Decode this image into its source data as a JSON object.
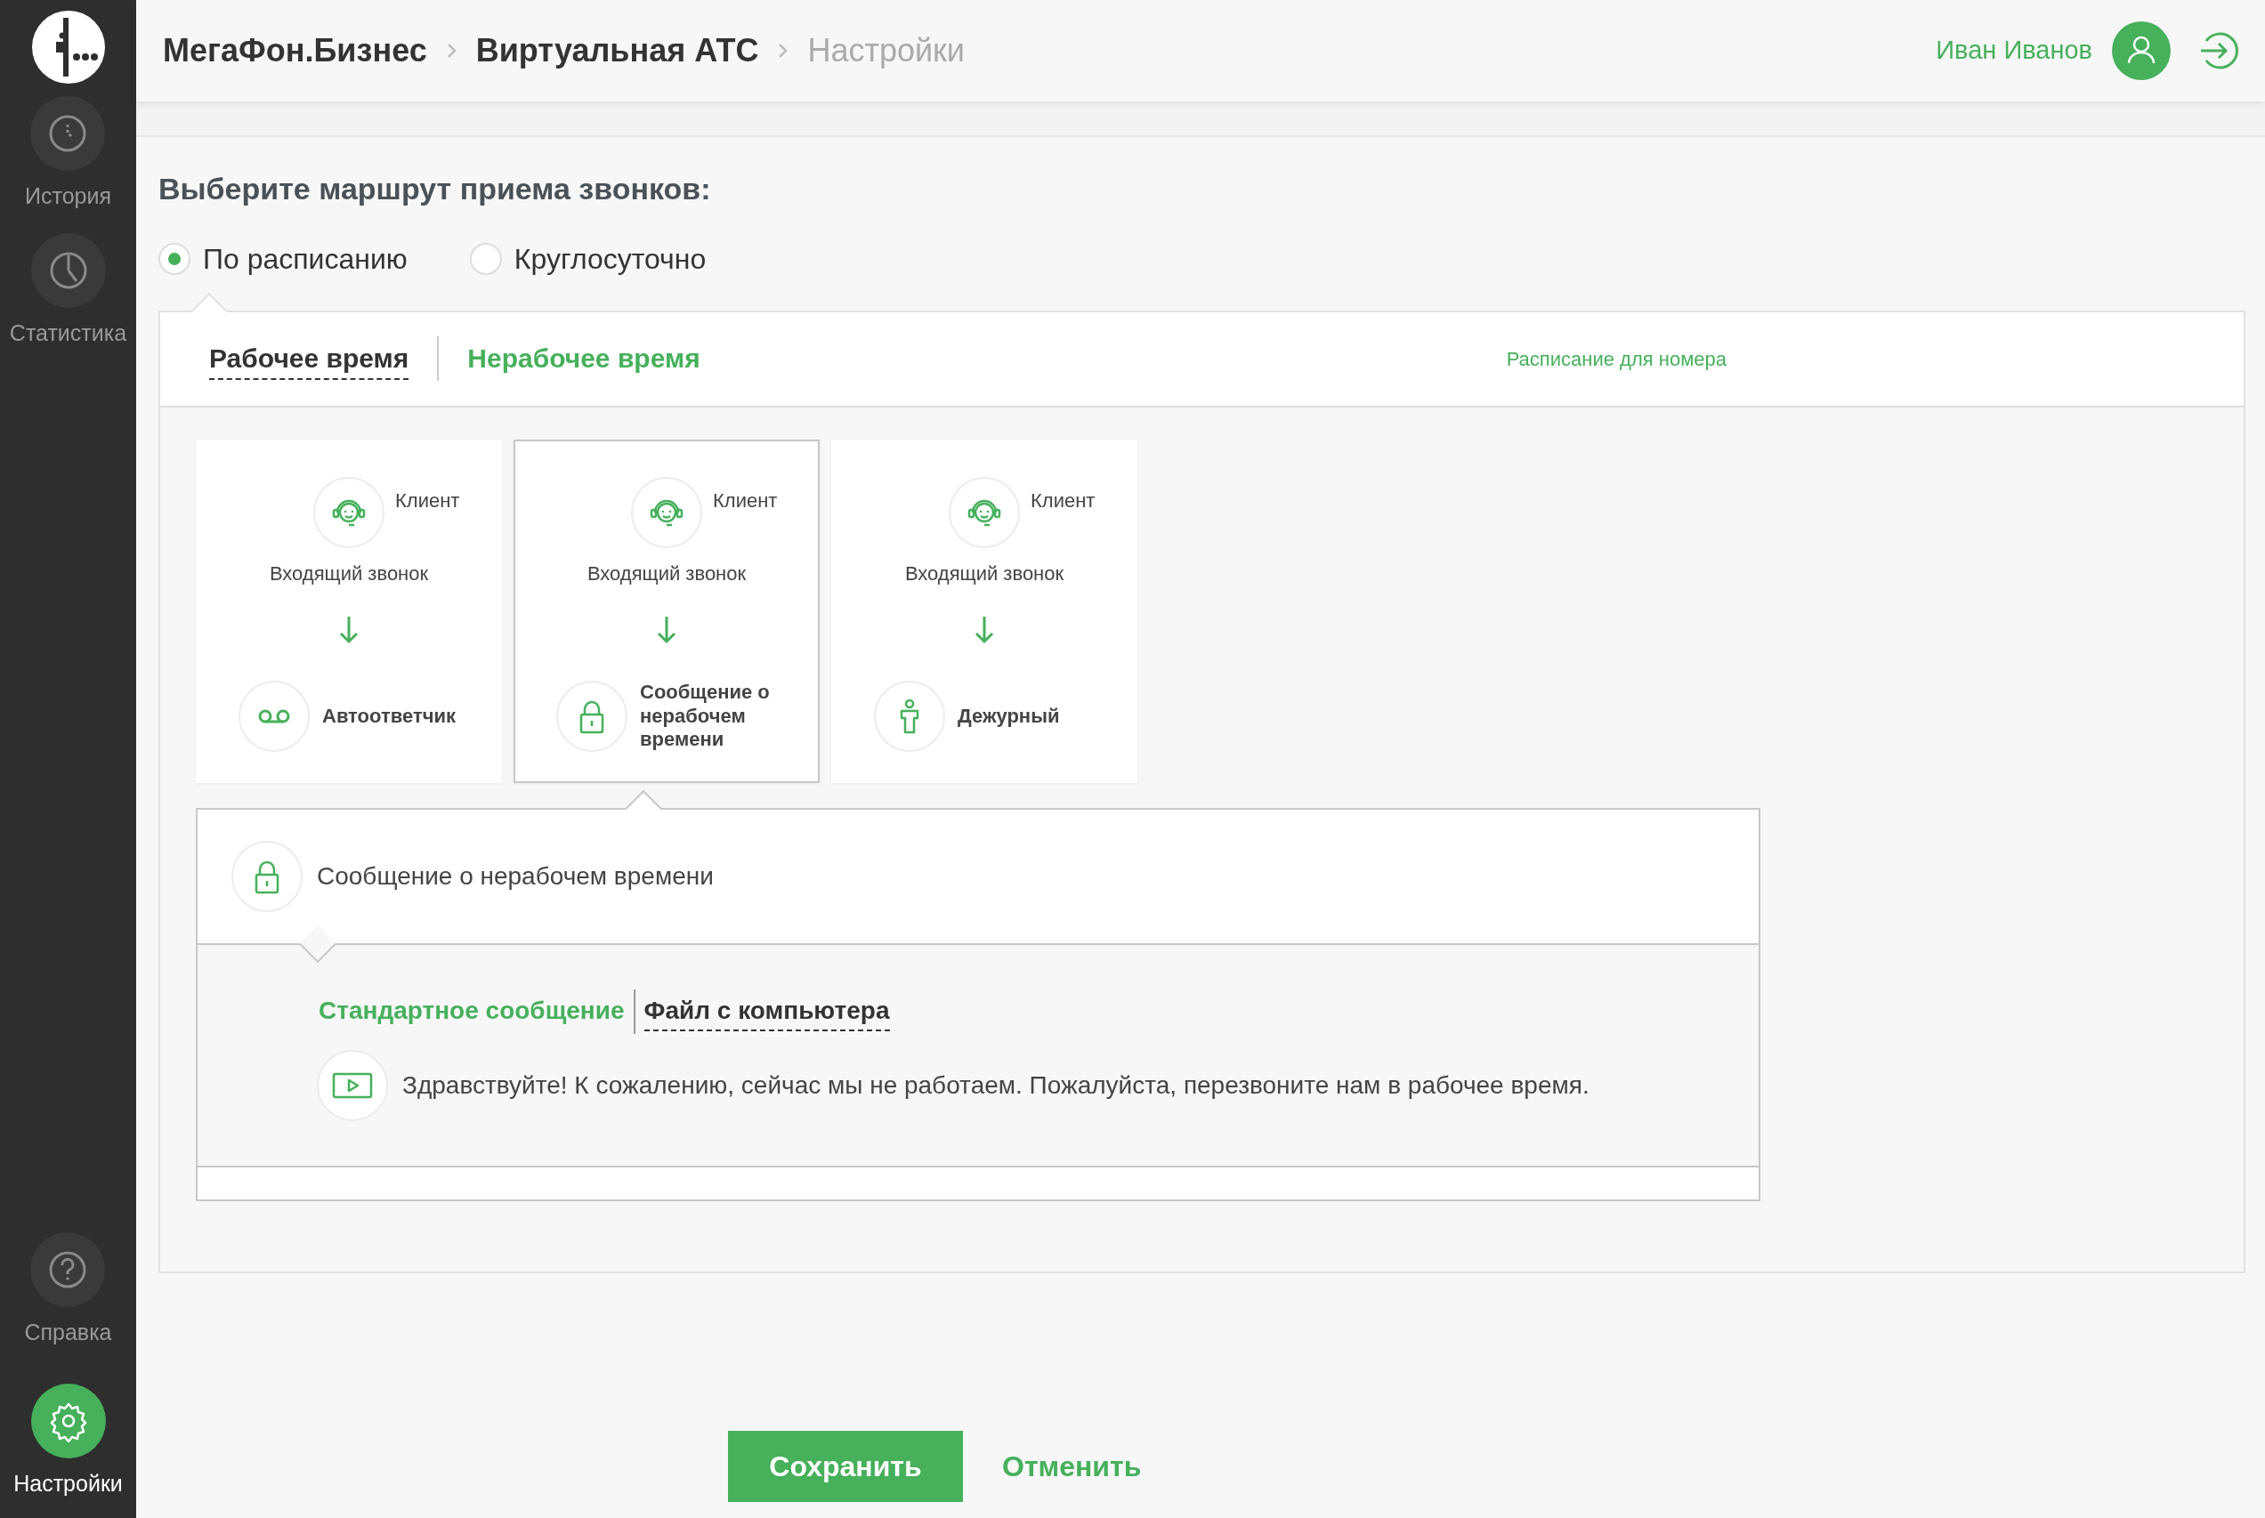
{
  "sidebar": {
    "items": [
      {
        "label": "История",
        "kind": "history",
        "selected": false
      },
      {
        "label": "Статистика",
        "kind": "stats",
        "selected": false
      }
    ],
    "bottom_items": [
      {
        "label": "Справка",
        "kind": "help",
        "selected": false
      },
      {
        "label": "Настройки",
        "kind": "settings",
        "selected": true
      }
    ]
  },
  "breadcrumbs": [
    {
      "label": "МегаФон.Бизнес",
      "current": false
    },
    {
      "label": "Виртуальная АТС",
      "current": false
    },
    {
      "label": "Настройки",
      "current": true
    }
  ],
  "user": {
    "name": "Иван Иванов"
  },
  "route_title": "Выберите маршрут приема звонков:",
  "route_options": [
    {
      "label": "По расписанию",
      "selected": true
    },
    {
      "label": "Круглосуточно",
      "selected": false
    }
  ],
  "tabs": [
    {
      "label": "Рабочее время",
      "selected": false
    },
    {
      "label": "Нерабочее время",
      "selected": true
    }
  ],
  "schedule_link": "Расписание для номера",
  "scenarios": [
    {
      "caller": "Клиент",
      "incoming": "Входящий звонок",
      "target": "Автоответчик",
      "kind": "voicemail",
      "selected": false
    },
    {
      "caller": "Клиент",
      "incoming": "Входящий звонок",
      "target": "Сообщение о нерабочем времени",
      "kind": "lock",
      "selected": true
    },
    {
      "caller": "Клиент",
      "incoming": "Входящий звонок",
      "target": "Дежурный",
      "kind": "person",
      "selected": false
    }
  ],
  "detail": {
    "title": "Сообщение о нерабочем времени",
    "source_tabs": [
      {
        "label": "Стандартное сообщение",
        "selected": true
      },
      {
        "label": "Файл с компьютера",
        "selected": false
      }
    ],
    "message": "Здравствуйте! К сожалению, сейчас мы не работаем. Пожалуйста, перезвоните нам в рабочее время."
  },
  "buttons": {
    "save": "Сохранить",
    "cancel": "Отменить"
  }
}
